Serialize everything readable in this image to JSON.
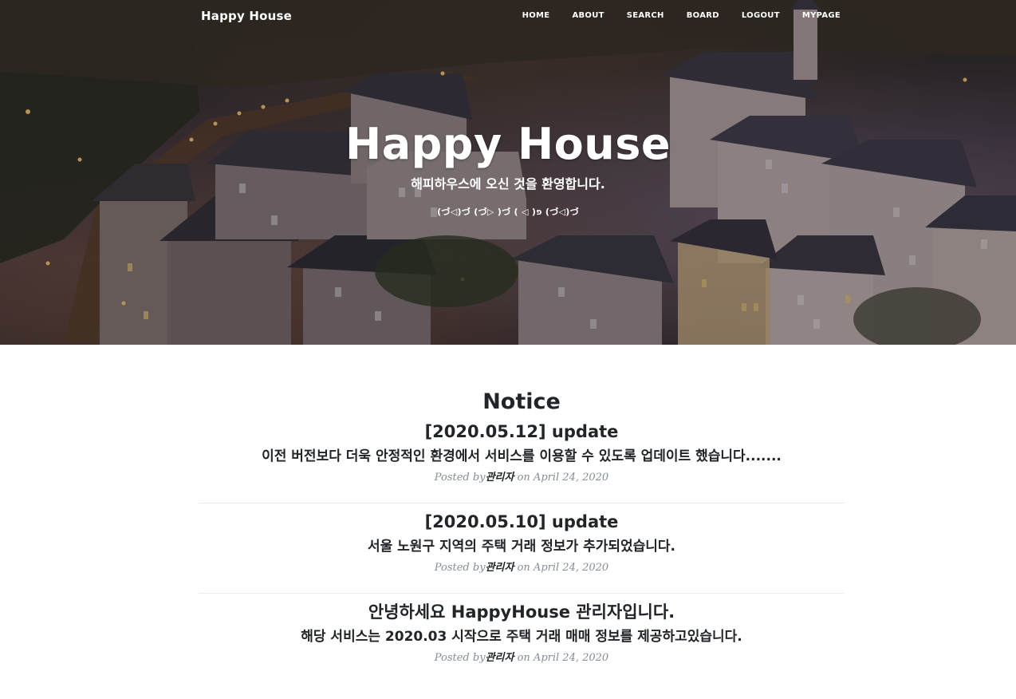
{
  "nav": {
    "brand": "Happy House",
    "links": [
      "HOME",
      "ABOUT",
      "SEARCH",
      "BOARD",
      "LOGOUT",
      "MYPAGE"
    ]
  },
  "hero": {
    "title": "Happy House",
    "subtitle": "해피하우스에 오신 것을 환영합니다.",
    "emoticon": "(づ◁)づ (づ▷ )づ ( ◁ )פ (づ◁)づ"
  },
  "notice": {
    "heading": "Notice",
    "posts": [
      {
        "title": "[2020.05.12] update",
        "subtitle": "이전 버전보다 더욱 안정적인 환경에서 서비스를 이용할 수 있도록 업데이트 했습니다.......",
        "posted_by": "Posted by",
        "author": "관리자",
        "date": "on April 24, 2020"
      },
      {
        "title": "[2020.05.10] update",
        "subtitle": "서울 노원구 지역의 주택 거래 정보가 추가되었습니다.",
        "posted_by": "Posted by",
        "author": "관리자",
        "date": "on April 24, 2020"
      },
      {
        "title": "안녕하세요 HappyHouse 관리자입니다.",
        "subtitle": "해당 서비스는 2020.03 시작으로 주택 거래 매매 정보를 제공하고있습니다.",
        "posted_by": "Posted by",
        "author": "관리자",
        "date": "on April 24, 2020"
      }
    ]
  }
}
